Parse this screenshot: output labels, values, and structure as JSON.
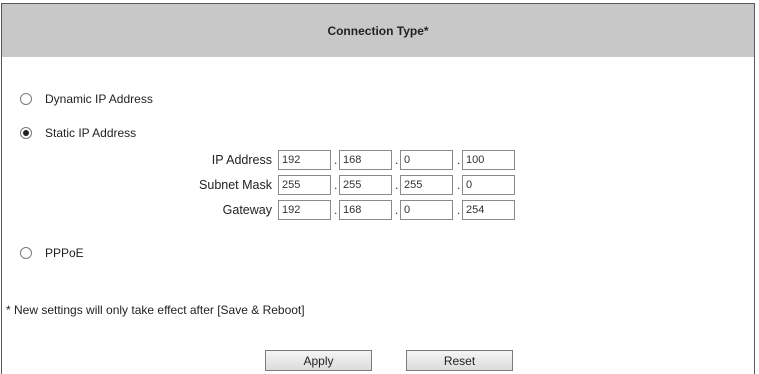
{
  "header": {
    "title": "Connection Type*"
  },
  "options": {
    "dynamic": {
      "label": "Dynamic IP Address",
      "selected": false
    },
    "static": {
      "label": "Static IP Address",
      "selected": true
    },
    "pppoe": {
      "label": "PPPoE",
      "selected": false
    }
  },
  "static_fields": {
    "ip_address": {
      "label": "IP Address",
      "octets": [
        "192",
        "168",
        "0",
        "100"
      ]
    },
    "subnet_mask": {
      "label": "Subnet Mask",
      "octets": [
        "255",
        "255",
        "255",
        "0"
      ]
    },
    "gateway": {
      "label": "Gateway",
      "octets": [
        "192",
        "168",
        "0",
        "254"
      ]
    }
  },
  "note": "* New settings will only take effect after [Save & Reboot]",
  "buttons": {
    "apply": "Apply",
    "reset": "Reset"
  },
  "colors": {
    "header_bg": "#c8c8c8",
    "border": "#5a5a5a"
  }
}
